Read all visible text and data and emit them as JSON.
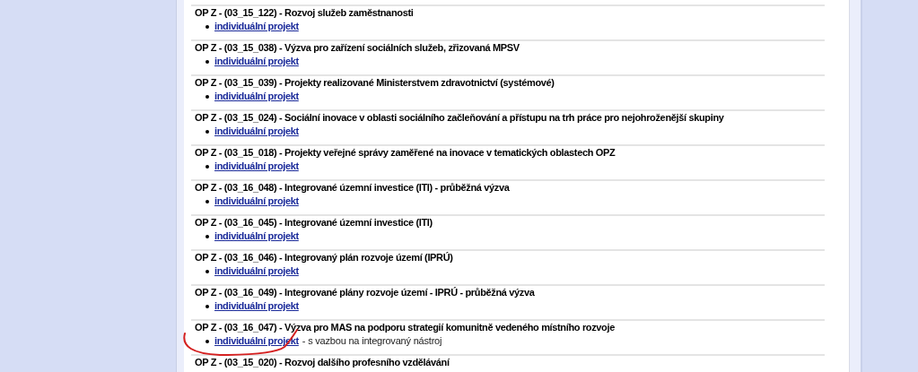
{
  "calls": [
    {
      "title": "OP Z - (03_15_122) - Rozvoj služeb zaměstnanosti",
      "links": [
        {
          "text": "individuální projekt"
        }
      ]
    },
    {
      "title": "OP Z - (03_15_038) - Výzva pro zařízení sociálních služeb, zřizovaná MPSV",
      "links": [
        {
          "text": "individuální projekt"
        }
      ]
    },
    {
      "title": "OP Z - (03_15_039) - Projekty realizované Ministerstvem zdravotnictví (systémové)",
      "links": [
        {
          "text": "individuální projekt"
        }
      ]
    },
    {
      "title": "OP Z - (03_15_024) - Sociální inovace v oblasti sociálního začleňování a přístupu na trh práce pro nejohroženější skupiny",
      "links": [
        {
          "text": "individuální projekt"
        }
      ]
    },
    {
      "title": "OP Z - (03_15_018) - Projekty veřejné správy zaměřené na inovace v tematických oblastech OPZ",
      "links": [
        {
          "text": "individuální projekt"
        }
      ]
    },
    {
      "title": "OP Z - (03_16_048) - Integrované územní investice (ITI) - průběžná výzva",
      "links": [
        {
          "text": "individuální projekt"
        }
      ]
    },
    {
      "title": "OP Z - (03_16_045) - Integrované územní investice (ITI)",
      "links": [
        {
          "text": "individuální projekt"
        }
      ]
    },
    {
      "title": "OP Z - (03_16_046) - Integrovaný plán rozvoje území (IPRÚ)",
      "links": [
        {
          "text": "individuální projekt"
        }
      ]
    },
    {
      "title": "OP Z - (03_16_049) - Integrované plány rozvoje území - IPRÚ - průběžná výzva",
      "links": [
        {
          "text": "individuální projekt"
        }
      ]
    },
    {
      "title": "OP Z - (03_16_047) - Výzva pro MAS na podporu strategií komunitně vedeného místního rozvoje",
      "links": [
        {
          "text": "individuální projekt",
          "note": "- s vazbou na integrovaný nástroj"
        }
      ]
    },
    {
      "title": "OP Z - (03_15_020) - Rozvoj dalšího profesního vzdělávání"
    }
  ],
  "annotation": {
    "kind": "curve",
    "color": "#d42020"
  }
}
